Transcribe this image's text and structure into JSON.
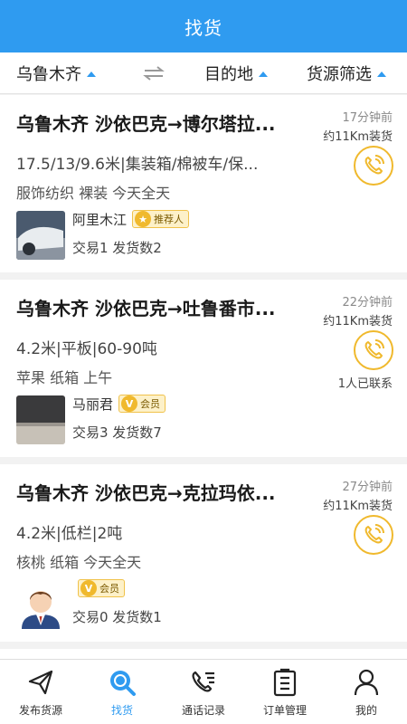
{
  "header": {
    "title": "找货"
  },
  "filters": {
    "origin": "乌鲁木齐",
    "destination": "目的地",
    "source_filter": "货源筛选"
  },
  "listings": [
    {
      "route": "乌鲁木齐 沙依巴克→博尔塔拉...",
      "spec": "17.5/13/9.6米|集装箱/棉被车/保...",
      "tags": "服饰纺织 裸装 今天全天",
      "time": "17分钟前",
      "distance": "约11Km装货",
      "contacted": "",
      "user_name": "阿里木江",
      "badge": "推荐人",
      "badge_icon": "medal-icon",
      "stats": "交易1 发货数2",
      "avatar": "car-photo"
    },
    {
      "route": "乌鲁木齐 沙依巴克→吐鲁番市...",
      "spec": "4.2米|平板|60-90吨",
      "tags": "苹果 纸箱 上午",
      "time": "22分钟前",
      "distance": "约11Km装货",
      "contacted": "1人已联系",
      "user_name": "马丽君",
      "badge": "会员",
      "badge_icon": "v-badge-icon",
      "stats": "交易3 发货数7",
      "avatar": "laptop-photo"
    },
    {
      "route": "乌鲁木齐 沙依巴克→克拉玛依...",
      "spec": "4.2米|低栏|2吨",
      "tags": "核桃 纸箱 今天全天",
      "time": "27分钟前",
      "distance": "约11Km装货",
      "contacted": "",
      "user_name": "",
      "badge": "会员",
      "badge_icon": "v-badge-icon",
      "stats": "交易0 发货数1",
      "avatar": "cartoon-person"
    }
  ],
  "tabs": [
    {
      "label": "发布货源",
      "icon": "paper-plane-icon",
      "active": false
    },
    {
      "label": "找货",
      "icon": "search-icon",
      "active": true
    },
    {
      "label": "通话记录",
      "icon": "phone-log-icon",
      "active": false
    },
    {
      "label": "订单管理",
      "icon": "clipboard-icon",
      "active": false
    },
    {
      "label": "我的",
      "icon": "person-icon",
      "active": false
    }
  ],
  "colors": {
    "primary": "#2f9bf0",
    "accent": "#f0b92d"
  }
}
